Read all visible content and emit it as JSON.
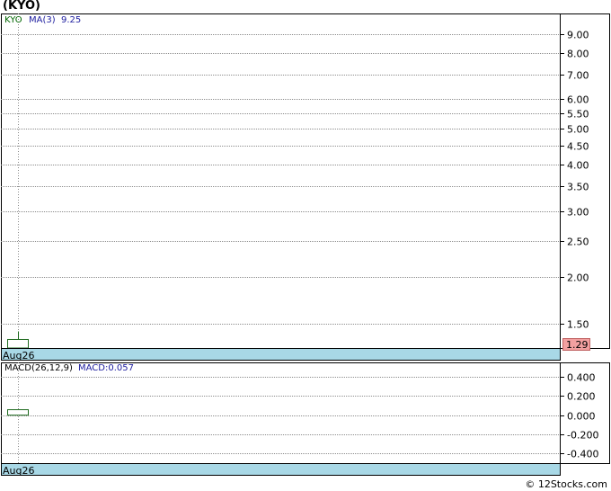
{
  "ticker_title": "(KYO)",
  "footer": "© 12Stocks.com",
  "chart_data": [
    {
      "type": "candlestick",
      "legend": {
        "symbol": "KYO",
        "ma_label": "MA(3)",
        "ma_value": "9.25"
      },
      "x_label": "Aug26",
      "y_scale": "log",
      "ylim": [
        1.29,
        10.2
      ],
      "y_ticks": [
        1.5,
        2.0,
        2.5,
        3.0,
        3.5,
        4.0,
        4.5,
        5.0,
        5.5,
        6.0,
        7.0,
        8.0,
        9.0
      ],
      "y_tick_labels": [
        "1.50",
        "2.00",
        "2.50",
        "3.00",
        "3.50",
        "4.00",
        "4.50",
        "5.00",
        "5.50",
        "6.00",
        "7.00",
        "8.00",
        "9.00"
      ],
      "last_price_label": "1.29",
      "last_price": 1.29,
      "candle": {
        "x": "Aug26",
        "open": 1.29,
        "close": 1.36,
        "high": 1.43,
        "low": 1.29
      },
      "grid": true,
      "colors": {
        "candle": "#1f6b1f",
        "band": "#a8d8e6",
        "price_box": "#f2a0a0",
        "symbol": "#006600",
        "ma": "#2020a0"
      }
    },
    {
      "type": "bar",
      "legend": {
        "label": "MACD(26,12,9)",
        "macd_label": "MACD:0.057"
      },
      "x_label": "Aug26",
      "ylim": [
        -0.5,
        0.55
      ],
      "y_ticks": [
        0.4,
        0.2,
        0.0,
        -0.2,
        -0.4
      ],
      "y_tick_labels": [
        "0.400",
        "0.200",
        "0.000",
        "-0.200",
        "-0.400"
      ],
      "macd_bar": {
        "x": "Aug26",
        "value": 0.057
      },
      "grid": true
    }
  ]
}
